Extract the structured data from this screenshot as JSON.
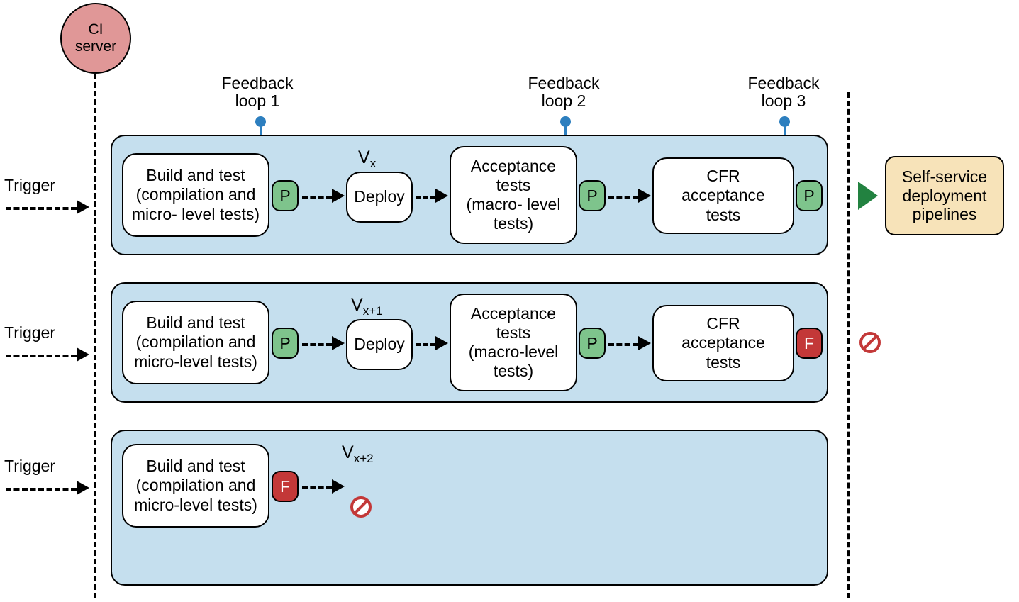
{
  "ci_server": "CI\nserver",
  "triggers": [
    "Trigger",
    "Trigger",
    "Trigger"
  ],
  "feedback_labels": [
    "Feedback\nloop 1",
    "Feedback\nloop 2",
    "Feedback\nloop 3"
  ],
  "versions": {
    "v1": "x",
    "v2": "x+1",
    "v3": "x+2"
  },
  "stages": {
    "build": "Build and test\n(compilation and\nmicro- level tests)",
    "build2": "Build and test\n(compilation and\nmicro-level tests)",
    "deploy": "Deploy",
    "acceptance": "Acceptance\ntests\n(macro- level\ntests)",
    "acceptance2": "Acceptance\ntests\n(macro-level\ntests)",
    "cfr": "CFR\nacceptance\ntests"
  },
  "badges": {
    "pass": "P",
    "fail": "F"
  },
  "self_service": "Self-service\ndeployment\npipelines",
  "version_prefix": "V"
}
